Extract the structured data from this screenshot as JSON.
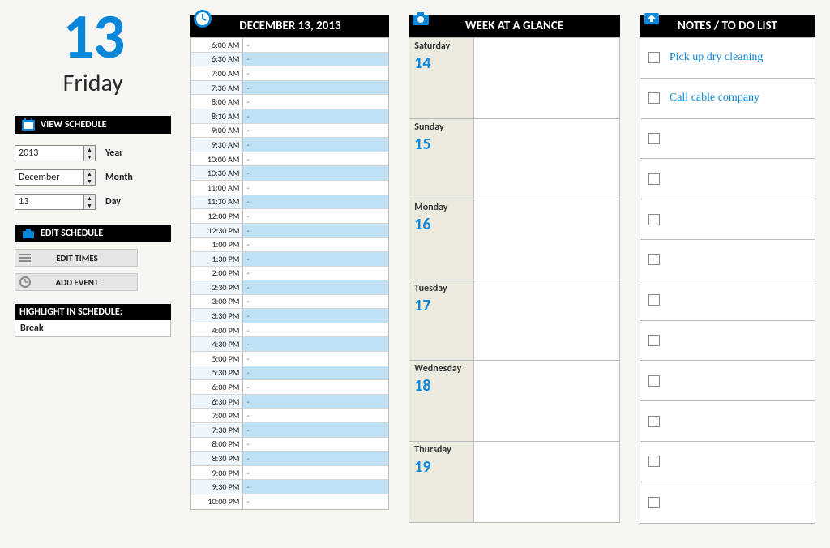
{
  "date": {
    "big_number": "13",
    "day_name": "Friday",
    "full": "DECEMBER 13, 2013"
  },
  "view_schedule": {
    "header": "VIEW SCHEDULE",
    "year_label": "Year",
    "year_value": "2013",
    "month_label": "Month",
    "month_value": "December",
    "day_label": "Day",
    "day_value": "13"
  },
  "edit_schedule": {
    "header": "EDIT SCHEDULE",
    "edit_times": "EDIT TIMES",
    "add_event": "ADD EVENT"
  },
  "highlight": {
    "header": "HIGHLIGHT IN SCHEDULE:",
    "value": "Break"
  },
  "day_schedule": {
    "slots": [
      {
        "t": "6:00 AM",
        "v": "-"
      },
      {
        "t": "6:30 AM",
        "v": "-"
      },
      {
        "t": "7:00 AM",
        "v": "-"
      },
      {
        "t": "7:30 AM",
        "v": "-"
      },
      {
        "t": "8:00 AM",
        "v": "-"
      },
      {
        "t": "8:30 AM",
        "v": "-"
      },
      {
        "t": "9:00 AM",
        "v": "-"
      },
      {
        "t": "9:30 AM",
        "v": "-"
      },
      {
        "t": "10:00 AM",
        "v": "-"
      },
      {
        "t": "10:30 AM",
        "v": "-"
      },
      {
        "t": "11:00 AM",
        "v": "-"
      },
      {
        "t": "11:30 AM",
        "v": "-"
      },
      {
        "t": "12:00 PM",
        "v": "-"
      },
      {
        "t": "12:30 PM",
        "v": "-"
      },
      {
        "t": "1:00 PM",
        "v": "-"
      },
      {
        "t": "1:30 PM",
        "v": "-"
      },
      {
        "t": "2:00 PM",
        "v": "-"
      },
      {
        "t": "2:30 PM",
        "v": "-"
      },
      {
        "t": "3:00 PM",
        "v": "-"
      },
      {
        "t": "3:30 PM",
        "v": "-"
      },
      {
        "t": "4:00 PM",
        "v": "-"
      },
      {
        "t": "4:30 PM",
        "v": "-"
      },
      {
        "t": "5:00 PM",
        "v": "-"
      },
      {
        "t": "5:30 PM",
        "v": "-"
      },
      {
        "t": "6:00 PM",
        "v": "-"
      },
      {
        "t": "6:30 PM",
        "v": "-"
      },
      {
        "t": "7:00 PM",
        "v": "-"
      },
      {
        "t": "7:30 PM",
        "v": "-"
      },
      {
        "t": "8:00 PM",
        "v": "-"
      },
      {
        "t": "8:30 PM",
        "v": "-"
      },
      {
        "t": "9:00 PM",
        "v": "-"
      },
      {
        "t": "9:30 PM",
        "v": "-"
      },
      {
        "t": "10:00 PM",
        "v": "-"
      }
    ]
  },
  "week": {
    "header": "WEEK AT A GLANCE",
    "days": [
      {
        "name": "Saturday",
        "num": "14"
      },
      {
        "name": "Sunday",
        "num": "15"
      },
      {
        "name": "Monday",
        "num": "16"
      },
      {
        "name": "Tuesday",
        "num": "17"
      },
      {
        "name": "Wednesday",
        "num": "18"
      },
      {
        "name": "Thursday",
        "num": "19"
      }
    ]
  },
  "notes": {
    "header": "NOTES / TO DO LIST",
    "items": [
      "Pick up dry cleaning",
      "Call cable company",
      "",
      "",
      "",
      "",
      "",
      "",
      "",
      "",
      "",
      ""
    ]
  }
}
